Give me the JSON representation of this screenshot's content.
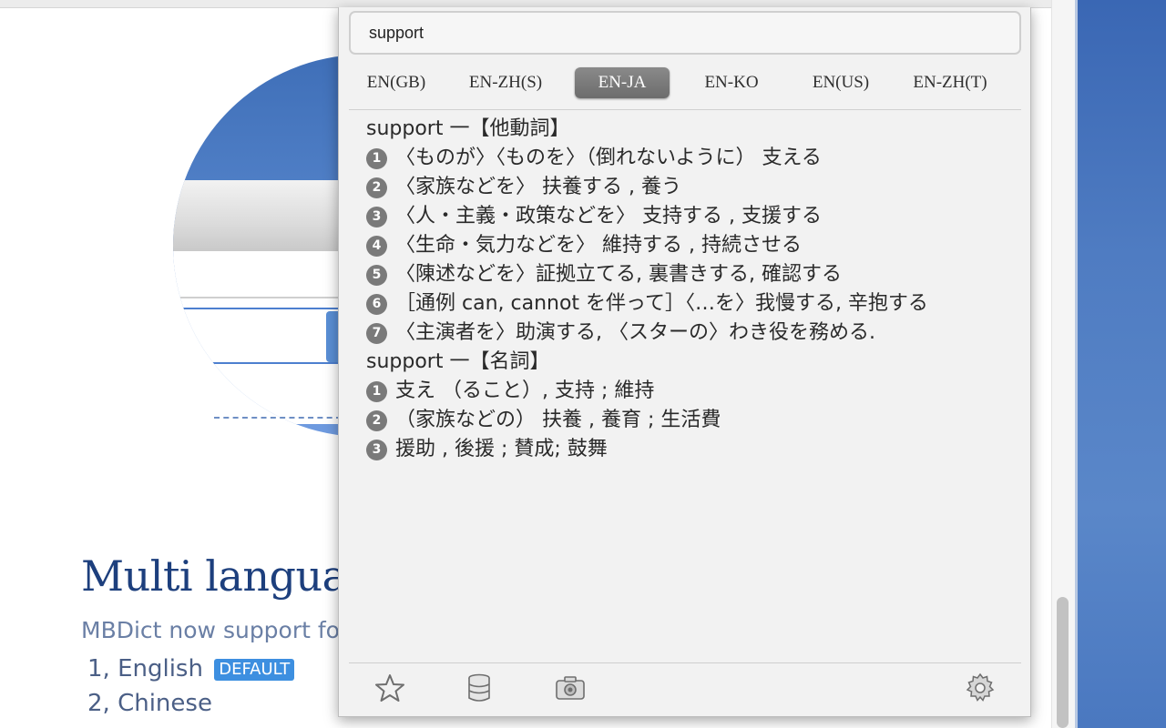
{
  "background_page": {
    "heading": "Multi languag",
    "intro": "MBDict now support fo",
    "languages": [
      {
        "label": "1, English",
        "badge": "DEFAULT"
      },
      {
        "label": "2, Chinese"
      }
    ]
  },
  "popup": {
    "search": {
      "value": "support"
    },
    "tabs": [
      {
        "label": "EN(GB)",
        "active": false
      },
      {
        "label": "EN-ZH(S)",
        "active": false
      },
      {
        "label": "EN-JA",
        "active": true
      },
      {
        "label": "EN-KO",
        "active": false
      },
      {
        "label": "EN(US)",
        "active": false
      },
      {
        "label": "EN-ZH(T)",
        "active": false
      }
    ],
    "definition": {
      "verb_heading": "support 一【他動詞】",
      "verb_senses": [
        {
          "num": "1",
          "text": "〈ものが〉〈ものを〉（倒れないように） 支える"
        },
        {
          "num": "2",
          "text": "〈家族などを〉 扶養する , 養う"
        },
        {
          "num": "3",
          "text": "〈人・主義・政策などを〉 支持する , 支援する"
        },
        {
          "num": "4",
          "text": "〈生命・気力などを〉 維持する , 持続させる"
        },
        {
          "num": "5",
          "text": "〈陳述などを〉証拠立てる, 裏書きする, 確認する"
        },
        {
          "num": "6",
          "text": "［通例 can, cannot を伴って］〈…を〉我慢する, 辛抱する"
        },
        {
          "num": "7",
          "text": "〈主演者を〉助演する, 〈スターの〉わき役を務める."
        }
      ],
      "noun_heading": "support 一【名詞】",
      "noun_senses": [
        {
          "num": "1",
          "text": "支え （ること）, 支持 ; 維持"
        },
        {
          "num": "2",
          "text": "（家族などの） 扶養 , 養育 ; 生活費"
        },
        {
          "num": "3",
          "text": "援助 , 後援 ; 賛成; 鼓舞"
        }
      ]
    },
    "footer_icons": [
      "star-icon",
      "database-icon",
      "camera-icon",
      "gear-icon"
    ]
  },
  "colors": {
    "active_tab": "#7a7a7a",
    "heading_blue": "#1d3f7d",
    "badge_blue": "#3d8fe0",
    "desktop_blue": "#4f7cc2"
  }
}
